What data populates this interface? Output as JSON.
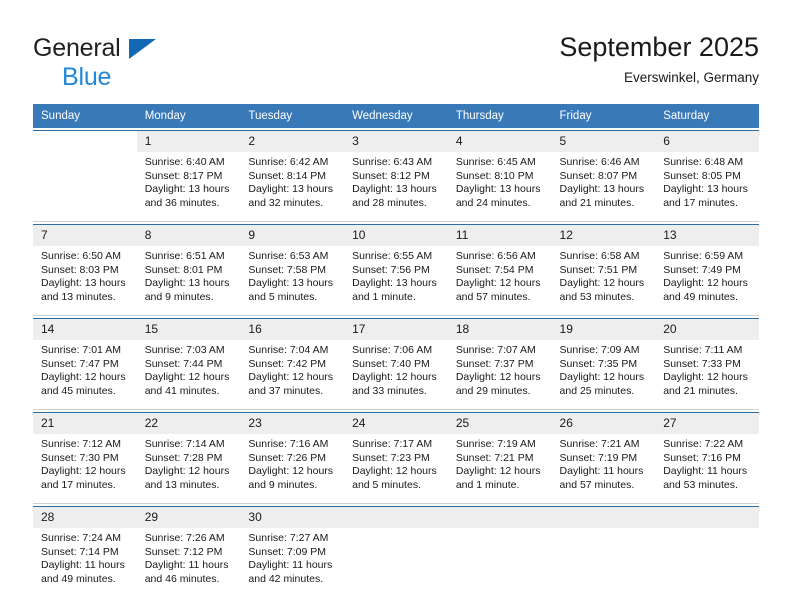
{
  "brand": {
    "name_part1": "General",
    "name_part2": "Blue",
    "accent_color": "#2288d6",
    "triangle_color": "#1268b3"
  },
  "header": {
    "title": "September 2025",
    "subtitle": "Everswinkel, Germany"
  },
  "calendar": {
    "header_bg": "#3a79b8",
    "daynum_bg": "#eeeeee",
    "separator_color": "#2e6da4",
    "weekday_headers": [
      "Sunday",
      "Monday",
      "Tuesday",
      "Wednesday",
      "Thursday",
      "Friday",
      "Saturday"
    ],
    "weeks": [
      [
        {
          "day": "",
          "blank": true,
          "sunrise": "",
          "sunset": "",
          "daylight_line1": "",
          "daylight_line2": ""
        },
        {
          "day": "1",
          "sunrise": "Sunrise: 6:40 AM",
          "sunset": "Sunset: 8:17 PM",
          "daylight_line1": "Daylight: 13 hours",
          "daylight_line2": "and 36 minutes."
        },
        {
          "day": "2",
          "sunrise": "Sunrise: 6:42 AM",
          "sunset": "Sunset: 8:14 PM",
          "daylight_line1": "Daylight: 13 hours",
          "daylight_line2": "and 32 minutes."
        },
        {
          "day": "3",
          "sunrise": "Sunrise: 6:43 AM",
          "sunset": "Sunset: 8:12 PM",
          "daylight_line1": "Daylight: 13 hours",
          "daylight_line2": "and 28 minutes."
        },
        {
          "day": "4",
          "sunrise": "Sunrise: 6:45 AM",
          "sunset": "Sunset: 8:10 PM",
          "daylight_line1": "Daylight: 13 hours",
          "daylight_line2": "and 24 minutes."
        },
        {
          "day": "5",
          "sunrise": "Sunrise: 6:46 AM",
          "sunset": "Sunset: 8:07 PM",
          "daylight_line1": "Daylight: 13 hours",
          "daylight_line2": "and 21 minutes."
        },
        {
          "day": "6",
          "sunrise": "Sunrise: 6:48 AM",
          "sunset": "Sunset: 8:05 PM",
          "daylight_line1": "Daylight: 13 hours",
          "daylight_line2": "and 17 minutes."
        }
      ],
      [
        {
          "day": "7",
          "sunrise": "Sunrise: 6:50 AM",
          "sunset": "Sunset: 8:03 PM",
          "daylight_line1": "Daylight: 13 hours",
          "daylight_line2": "and 13 minutes."
        },
        {
          "day": "8",
          "sunrise": "Sunrise: 6:51 AM",
          "sunset": "Sunset: 8:01 PM",
          "daylight_line1": "Daylight: 13 hours",
          "daylight_line2": "and 9 minutes."
        },
        {
          "day": "9",
          "sunrise": "Sunrise: 6:53 AM",
          "sunset": "Sunset: 7:58 PM",
          "daylight_line1": "Daylight: 13 hours",
          "daylight_line2": "and 5 minutes."
        },
        {
          "day": "10",
          "sunrise": "Sunrise: 6:55 AM",
          "sunset": "Sunset: 7:56 PM",
          "daylight_line1": "Daylight: 13 hours",
          "daylight_line2": "and 1 minute."
        },
        {
          "day": "11",
          "sunrise": "Sunrise: 6:56 AM",
          "sunset": "Sunset: 7:54 PM",
          "daylight_line1": "Daylight: 12 hours",
          "daylight_line2": "and 57 minutes."
        },
        {
          "day": "12",
          "sunrise": "Sunrise: 6:58 AM",
          "sunset": "Sunset: 7:51 PM",
          "daylight_line1": "Daylight: 12 hours",
          "daylight_line2": "and 53 minutes."
        },
        {
          "day": "13",
          "sunrise": "Sunrise: 6:59 AM",
          "sunset": "Sunset: 7:49 PM",
          "daylight_line1": "Daylight: 12 hours",
          "daylight_line2": "and 49 minutes."
        }
      ],
      [
        {
          "day": "14",
          "sunrise": "Sunrise: 7:01 AM",
          "sunset": "Sunset: 7:47 PM",
          "daylight_line1": "Daylight: 12 hours",
          "daylight_line2": "and 45 minutes."
        },
        {
          "day": "15",
          "sunrise": "Sunrise: 7:03 AM",
          "sunset": "Sunset: 7:44 PM",
          "daylight_line1": "Daylight: 12 hours",
          "daylight_line2": "and 41 minutes."
        },
        {
          "day": "16",
          "sunrise": "Sunrise: 7:04 AM",
          "sunset": "Sunset: 7:42 PM",
          "daylight_line1": "Daylight: 12 hours",
          "daylight_line2": "and 37 minutes."
        },
        {
          "day": "17",
          "sunrise": "Sunrise: 7:06 AM",
          "sunset": "Sunset: 7:40 PM",
          "daylight_line1": "Daylight: 12 hours",
          "daylight_line2": "and 33 minutes."
        },
        {
          "day": "18",
          "sunrise": "Sunrise: 7:07 AM",
          "sunset": "Sunset: 7:37 PM",
          "daylight_line1": "Daylight: 12 hours",
          "daylight_line2": "and 29 minutes."
        },
        {
          "day": "19",
          "sunrise": "Sunrise: 7:09 AM",
          "sunset": "Sunset: 7:35 PM",
          "daylight_line1": "Daylight: 12 hours",
          "daylight_line2": "and 25 minutes."
        },
        {
          "day": "20",
          "sunrise": "Sunrise: 7:11 AM",
          "sunset": "Sunset: 7:33 PM",
          "daylight_line1": "Daylight: 12 hours",
          "daylight_line2": "and 21 minutes."
        }
      ],
      [
        {
          "day": "21",
          "sunrise": "Sunrise: 7:12 AM",
          "sunset": "Sunset: 7:30 PM",
          "daylight_line1": "Daylight: 12 hours",
          "daylight_line2": "and 17 minutes."
        },
        {
          "day": "22",
          "sunrise": "Sunrise: 7:14 AM",
          "sunset": "Sunset: 7:28 PM",
          "daylight_line1": "Daylight: 12 hours",
          "daylight_line2": "and 13 minutes."
        },
        {
          "day": "23",
          "sunrise": "Sunrise: 7:16 AM",
          "sunset": "Sunset: 7:26 PM",
          "daylight_line1": "Daylight: 12 hours",
          "daylight_line2": "and 9 minutes."
        },
        {
          "day": "24",
          "sunrise": "Sunrise: 7:17 AM",
          "sunset": "Sunset: 7:23 PM",
          "daylight_line1": "Daylight: 12 hours",
          "daylight_line2": "and 5 minutes."
        },
        {
          "day": "25",
          "sunrise": "Sunrise: 7:19 AM",
          "sunset": "Sunset: 7:21 PM",
          "daylight_line1": "Daylight: 12 hours",
          "daylight_line2": "and 1 minute."
        },
        {
          "day": "26",
          "sunrise": "Sunrise: 7:21 AM",
          "sunset": "Sunset: 7:19 PM",
          "daylight_line1": "Daylight: 11 hours",
          "daylight_line2": "and 57 minutes."
        },
        {
          "day": "27",
          "sunrise": "Sunrise: 7:22 AM",
          "sunset": "Sunset: 7:16 PM",
          "daylight_line1": "Daylight: 11 hours",
          "daylight_line2": "and 53 minutes."
        }
      ],
      [
        {
          "day": "28",
          "sunrise": "Sunrise: 7:24 AM",
          "sunset": "Sunset: 7:14 PM",
          "daylight_line1": "Daylight: 11 hours",
          "daylight_line2": "and 49 minutes."
        },
        {
          "day": "29",
          "sunrise": "Sunrise: 7:26 AM",
          "sunset": "Sunset: 7:12 PM",
          "daylight_line1": "Daylight: 11 hours",
          "daylight_line2": "and 46 minutes."
        },
        {
          "day": "30",
          "sunrise": "Sunrise: 7:27 AM",
          "sunset": "Sunset: 7:09 PM",
          "daylight_line1": "Daylight: 11 hours",
          "daylight_line2": "and 42 minutes."
        },
        {
          "day": "",
          "empty": true,
          "sunrise": "",
          "sunset": "",
          "daylight_line1": "",
          "daylight_line2": ""
        },
        {
          "day": "",
          "empty": true,
          "sunrise": "",
          "sunset": "",
          "daylight_line1": "",
          "daylight_line2": ""
        },
        {
          "day": "",
          "empty": true,
          "sunrise": "",
          "sunset": "",
          "daylight_line1": "",
          "daylight_line2": ""
        },
        {
          "day": "",
          "empty": true,
          "sunrise": "",
          "sunset": "",
          "daylight_line1": "",
          "daylight_line2": ""
        }
      ]
    ]
  }
}
